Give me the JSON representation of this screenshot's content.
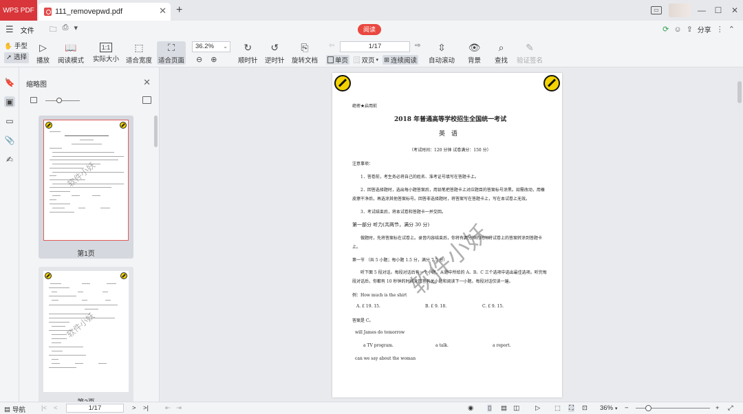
{
  "app": {
    "logo": "WPS PDF",
    "doc_tab": "111_removepwd.pdf"
  },
  "menubar": {
    "file": "文件",
    "read_badge": "阅读",
    "share": "分享"
  },
  "toolbar": {
    "hand": "手型",
    "select": "选择",
    "play": "播放",
    "read_mode": "阅读模式",
    "actual_size": "实际大小",
    "actual_size_icon": "1:1",
    "fit_width": "适合宽度",
    "fit_page": "适合页面",
    "zoom": "36.2%",
    "clockwise": "顺时针",
    "counterclockwise": "逆时针",
    "rotate_doc": "旋转文档",
    "page_indicator": "1/17",
    "single_page": "单页",
    "double_page": "双页",
    "continuous": "连续阅读",
    "auto_scroll": "自动滚动",
    "background": "背景",
    "find": "查找",
    "verify_sign": "验证签名"
  },
  "thumbnails": {
    "title": "缩略图",
    "page1_label": "第1页",
    "page2_label": "第2页"
  },
  "page": {
    "line1": "绝密★启用前",
    "title": "2018 年普通高等学校招生全国统一考试",
    "subject": "英 语",
    "exam_info": "（考试时间：120 分钟  试卷满分：150 分）",
    "notes_title": "注意事项：",
    "note1": "1．答卷前，考生务必将自己的姓名、准考证号填写在答题卡上。",
    "note2a": "2．回答选择题时，选出每小题答案后，用铅笔把答题卡上对应题目的答案标号涂黑。如需改动，用橡",
    "note2b": "皮擦干净后，再选涂其他答案标号。回答非选择题时，将答案写在答题卡上，写在本试卷上无效。",
    "note3": "3．考试结束后，将本试卷和答题卡一并交回。",
    "part1": "第一部分  听力(共两节，满分 30 分)",
    "part1_desc_a": "做题时，先将答案标在试卷上。录音内容结束后，你将有两分钟的时间将试卷上的答案转涂到答题卡",
    "part1_desc_b": "上。",
    "section1": "第一节  （共 5 小题；每小题 1.5 分，满分 7.5 分）",
    "section1_desc_a": "听下面 5 段对话。每段对话后有一个小题，从题中所给的 A、B、C 三个选项中选出最佳选项。听完每",
    "section1_desc_b": "段对话后，你都有 10 秒钟的时间来回答有关小题和阅读下一小题。每段对话仅读一遍。",
    "example": "例：How much is the shirt",
    "opt_a": "A. £ 19. 15.",
    "opt_b": "B. £ 9. 18.",
    "opt_c": "C. £ 9. 15.",
    "answer": "答案是 C。",
    "q1": "will James do tomorrow",
    "q1_a": "a TV program.",
    "q1_b": "a talk.",
    "q1_c": "a report.",
    "q2": "can we say about the woman",
    "watermark": "软件小妖"
  },
  "statusbar": {
    "nav": "导航",
    "page": "1/17",
    "zoom": "36%"
  }
}
